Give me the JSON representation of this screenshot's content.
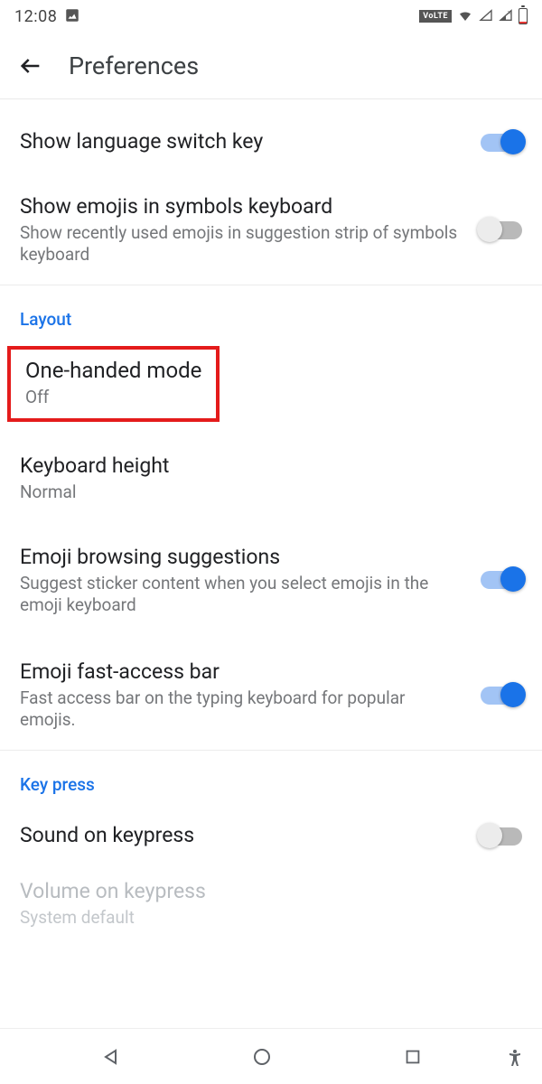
{
  "status": {
    "time": "12:08",
    "volte": "VoLTE"
  },
  "header": {
    "title": "Preferences"
  },
  "items": {
    "lang_switch": {
      "title": "Show language switch key"
    },
    "emoji_symbols": {
      "title": "Show emojis in symbols keyboard",
      "sub": "Show recently used emojis in suggestion strip of symbols keyboard"
    },
    "one_handed": {
      "title": "One-handed mode",
      "sub": "Off"
    },
    "kbd_height": {
      "title": "Keyboard height",
      "sub": "Normal"
    },
    "emoji_browse": {
      "title": "Emoji browsing suggestions",
      "sub": "Suggest sticker content when you select emojis in the emoji keyboard"
    },
    "emoji_fast": {
      "title": "Emoji fast-access bar",
      "sub": "Fast access bar on the typing keyboard for popular emojis."
    },
    "sound": {
      "title": "Sound on keypress"
    },
    "volume": {
      "title": "Volume on keypress",
      "sub": "System default"
    }
  },
  "sections": {
    "layout": "Layout",
    "keypress": "Key press"
  }
}
